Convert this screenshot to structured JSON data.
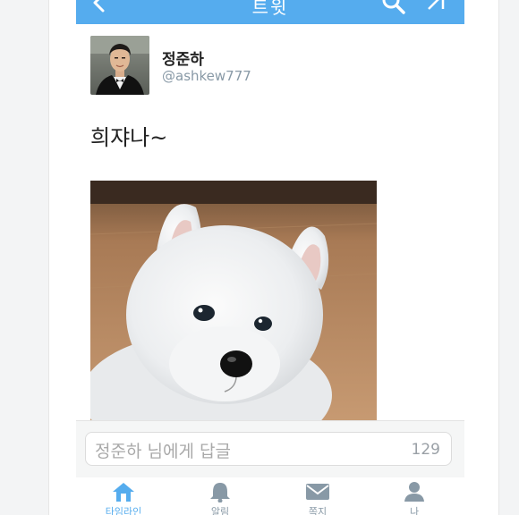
{
  "header": {
    "title": "트윗"
  },
  "tweet": {
    "author_name": "정준하",
    "author_handle": "@ashkew777",
    "text": "희쟈나~"
  },
  "reply": {
    "placeholder": "정준하 님에게 답글",
    "char_count": "129"
  },
  "tabs": [
    {
      "label": "타임라인",
      "icon": "home-icon",
      "active": true
    },
    {
      "label": "알림",
      "icon": "bell-icon",
      "active": false
    },
    {
      "label": "쪽지",
      "icon": "envelope-icon",
      "active": false
    },
    {
      "label": "나",
      "icon": "person-icon",
      "active": false
    }
  ],
  "colors": {
    "accent": "#55acee",
    "muted": "#8899a6"
  }
}
